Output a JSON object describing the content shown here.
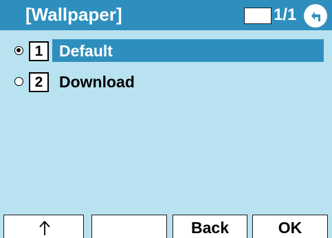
{
  "header": {
    "title": "[Wallpaper]",
    "page_indicator": "1/1",
    "back_icon": "back-arrow-icon"
  },
  "menu": {
    "items": [
      {
        "number": "1",
        "label": "Default",
        "selected": true
      },
      {
        "number": "2",
        "label": "Download",
        "selected": false
      }
    ]
  },
  "softkeys": {
    "key1_icon": "up-arrow-icon",
    "key2_label": "",
    "key3_label": "Back",
    "key4_label": "OK"
  },
  "colors": {
    "accent": "#2e8fbe",
    "background": "#b8e2f0"
  }
}
